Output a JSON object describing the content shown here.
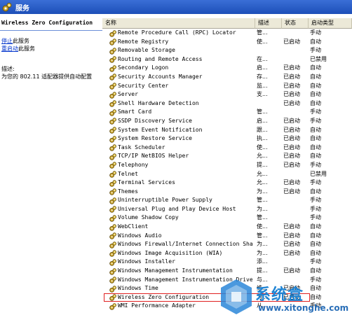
{
  "window": {
    "title": "服务"
  },
  "detail": {
    "service_name": "Wireless Zero Configuration",
    "actions": [
      {
        "link": "停止",
        "rest": "此服务"
      },
      {
        "link": "重启动",
        "rest": "此服务"
      }
    ],
    "description_label": "描述:",
    "description_text": "为您的 802.11 适配器提供自动配置"
  },
  "columns": {
    "name": "名称",
    "description": "描述",
    "status": "状态",
    "startup": "启动类型"
  },
  "services": [
    {
      "name": "Remote Procedure Call (RPC) Locator",
      "desc": "管...",
      "status": "",
      "startup": "手动"
    },
    {
      "name": "Remote Registry",
      "desc": "使...",
      "status": "已启动",
      "startup": "自动"
    },
    {
      "name": "Removable Storage",
      "desc": "",
      "status": "",
      "startup": "手动"
    },
    {
      "name": "Routing and Remote Access",
      "desc": "在...",
      "status": "",
      "startup": "已禁用"
    },
    {
      "name": "Secondary Logon",
      "desc": "启...",
      "status": "已启动",
      "startup": "自动"
    },
    {
      "name": "Security Accounts Manager",
      "desc": "存...",
      "status": "已启动",
      "startup": "自动"
    },
    {
      "name": "Security Center",
      "desc": "监...",
      "status": "已启动",
      "startup": "自动"
    },
    {
      "name": "Server",
      "desc": "支...",
      "status": "已启动",
      "startup": "自动"
    },
    {
      "name": "Shell Hardware Detection",
      "desc": "",
      "status": "已启动",
      "startup": "自动"
    },
    {
      "name": "Smart Card",
      "desc": "管...",
      "status": "",
      "startup": "手动"
    },
    {
      "name": "SSDP Discovery Service",
      "desc": "启...",
      "status": "已启动",
      "startup": "手动"
    },
    {
      "name": "System Event Notification",
      "desc": "跟...",
      "status": "已启动",
      "startup": "自动"
    },
    {
      "name": "System Restore Service",
      "desc": "执...",
      "status": "已启动",
      "startup": "自动"
    },
    {
      "name": "Task Scheduler",
      "desc": "使...",
      "status": "已启动",
      "startup": "自动"
    },
    {
      "name": "TCP/IP NetBIOS Helper",
      "desc": "允...",
      "status": "已启动",
      "startup": "自动"
    },
    {
      "name": "Telephony",
      "desc": "提...",
      "status": "已启动",
      "startup": "手动"
    },
    {
      "name": "Telnet",
      "desc": "允...",
      "status": "",
      "startup": "已禁用"
    },
    {
      "name": "Terminal Services",
      "desc": "允...",
      "status": "已启动",
      "startup": "手动"
    },
    {
      "name": "Themes",
      "desc": "为...",
      "status": "已启动",
      "startup": "自动"
    },
    {
      "name": "Uninterruptible Power Supply",
      "desc": "管...",
      "status": "",
      "startup": "手动"
    },
    {
      "name": "Universal Plug and Play Device Host",
      "desc": "为...",
      "status": "",
      "startup": "手动"
    },
    {
      "name": "Volume Shadow Copy",
      "desc": "管...",
      "status": "",
      "startup": "手动"
    },
    {
      "name": "WebClient",
      "desc": "使...",
      "status": "已启动",
      "startup": "自动"
    },
    {
      "name": "Windows Audio",
      "desc": "管...",
      "status": "已启动",
      "startup": "自动"
    },
    {
      "name": "Windows Firewall/Internet Connection Sha...",
      "desc": "为...",
      "status": "已启动",
      "startup": "自动"
    },
    {
      "name": "Windows Image Acquisition (WIA)",
      "desc": "为...",
      "status": "已启动",
      "startup": "自动"
    },
    {
      "name": "Windows Installer",
      "desc": "添...",
      "status": "",
      "startup": "手动"
    },
    {
      "name": "Windows Management Instrumentation",
      "desc": "提...",
      "status": "已启动",
      "startup": "自动"
    },
    {
      "name": "Windows Management Instrumentation Drive...",
      "desc": "与...",
      "status": "",
      "startup": "手动"
    },
    {
      "name": "Windows Time",
      "desc": "维...",
      "status": "已启动",
      "startup": "自动"
    },
    {
      "name": "Wireless Zero Configuration",
      "desc": "为...",
      "status": "已启动",
      "startup": "自动",
      "highlighted": true
    },
    {
      "name": "WMI Performance Adapter",
      "desc": "从...",
      "status": "",
      "startup": "手动"
    }
  ],
  "watermark": {
    "logo_text": "系统盒",
    "url": "www.xitonghe.com"
  },
  "colors": {
    "titlebar": "#1d4fb8",
    "link": "#0033cc",
    "highlight_border": "#e02020",
    "watermark": "#1f84d4"
  }
}
